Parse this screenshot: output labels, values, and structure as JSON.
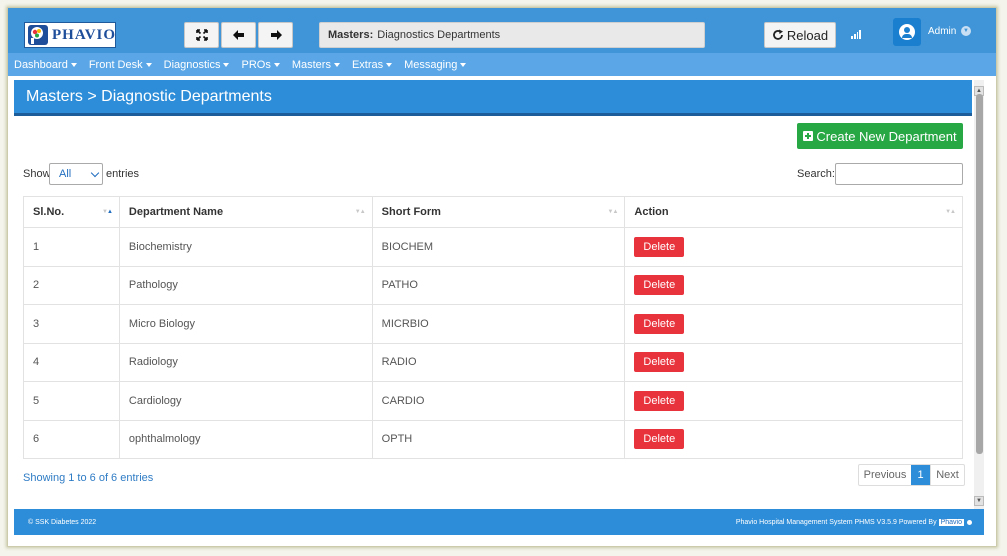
{
  "app": {
    "logo_text": "PHAVIO"
  },
  "toolbar": {
    "fullscreen_icon": "expand-icon",
    "back_icon": "arrow-left-icon",
    "forward_icon": "arrow-right-icon",
    "breadcrumb_label": "Masters:",
    "breadcrumb_value": "Diagnostics Departments",
    "reload_label": "Reload",
    "user_name": "Admin"
  },
  "nav": {
    "items": [
      {
        "label": "Dashboard"
      },
      {
        "label": "Front Desk"
      },
      {
        "label": "Diagnostics"
      },
      {
        "label": "PROs"
      },
      {
        "label": "Masters"
      },
      {
        "label": "Extras"
      },
      {
        "label": "Messaging"
      }
    ]
  },
  "page": {
    "title": "Masters > Diagnostic Departments",
    "create_label": "Create New Department",
    "show_label": "Show",
    "entries_value": "All",
    "entries_label": "entries",
    "search_label": "Search:"
  },
  "table": {
    "headers": [
      "Sl.No.",
      "Department Name",
      "Short Form",
      "Action"
    ],
    "rows": [
      {
        "sl": "1",
        "name": "Biochemistry",
        "short": "BIOCHEM",
        "action": "Delete"
      },
      {
        "sl": "2",
        "name": "Pathology",
        "short": "PATHO",
        "action": "Delete"
      },
      {
        "sl": "3",
        "name": "Micro Biology",
        "short": "MICRBIO",
        "action": "Delete"
      },
      {
        "sl": "4",
        "name": "Radiology",
        "short": "RADIO",
        "action": "Delete"
      },
      {
        "sl": "5",
        "name": "Cardiology",
        "short": "CARDIO",
        "action": "Delete"
      },
      {
        "sl": "6",
        "name": "ophthalmology",
        "short": "OPTH",
        "action": "Delete"
      }
    ]
  },
  "pagination": {
    "info": "Showing 1 to 6 of 6 entries",
    "previous": "Previous",
    "current": "1",
    "next": "Next"
  },
  "footer": {
    "copyright": "© SSK Diabetes 2022",
    "system": "Phavio Hospital Management System PHMS V3.5.9 Powered By",
    "brand": "Phavio"
  },
  "colors": {
    "header_blue": "#3f95d7",
    "nav_blue": "#5aa6e6",
    "accent_blue": "#2e8dd8",
    "success_green": "#28a745",
    "danger_red": "#e8323c"
  }
}
